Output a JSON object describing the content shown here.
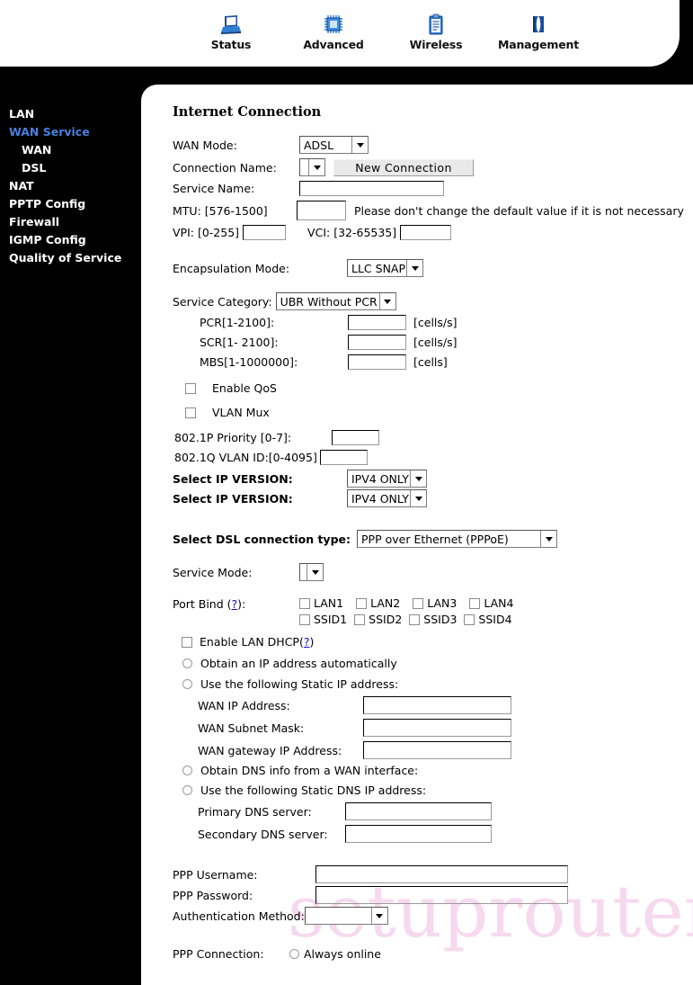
{
  "topnav": {
    "items": [
      {
        "label": "Status",
        "icon": "monitor-icon"
      },
      {
        "label": "Advanced",
        "icon": "chip-icon"
      },
      {
        "label": "Wireless",
        "icon": "clipboard-icon"
      },
      {
        "label": "Management",
        "icon": "book-icon"
      }
    ]
  },
  "sidebar": {
    "items": [
      {
        "label": "LAN",
        "active": false,
        "sub": false
      },
      {
        "label": "WAN Service",
        "active": true,
        "sub": false
      },
      {
        "label": "WAN",
        "active": false,
        "sub": true
      },
      {
        "label": "DSL",
        "active": false,
        "sub": true
      },
      {
        "label": "NAT",
        "active": false,
        "sub": false
      },
      {
        "label": "PPTP Config",
        "active": false,
        "sub": false
      },
      {
        "label": "Firewall",
        "active": false,
        "sub": false
      },
      {
        "label": "IGMP Config",
        "active": false,
        "sub": false
      },
      {
        "label": "Quality of Service",
        "active": false,
        "sub": false
      }
    ]
  },
  "watermark": {
    "text": "setuprouter"
  },
  "page": {
    "title": "Internet Connection",
    "wan_mode_label": "WAN Mode:",
    "wan_mode_value": "ADSL",
    "connection_name_label": "Connection Name:",
    "connection_name_value": "",
    "new_connection_button": "New Connection",
    "service_name_label": "Service Name:",
    "service_name_value": "",
    "mtu_label": "MTU: [576-1500]",
    "mtu_value": "",
    "mtu_note": "Please don't change the default value if it is not necessary",
    "vpi_label": "VPI: [0-255]",
    "vpi_value": "",
    "vci_label": "VCI: [32-65535]",
    "vci_value": "",
    "encapsulation_label": "Encapsulation Mode:",
    "encapsulation_value": "LLC SNAP",
    "service_category_label": "Service Category:",
    "service_category_value": "UBR Without PCR",
    "pcr_label": "PCR[1-2100]:",
    "pcr_value": "",
    "pcr_unit": "[cells/s]",
    "scr_label": "SCR[1- 2100]:",
    "scr_value": "",
    "scr_unit": "[cells/s]",
    "mbs_label": "MBS[1-1000000]:",
    "mbs_value": "",
    "mbs_unit": "[cells]",
    "enable_qos_label": "Enable QoS",
    "vlan_mux_label": "VLAN Mux",
    "p8021p_label": "802.1P Priority [0-7]:",
    "p8021p_value": "",
    "q8021q_label": "802.1Q VLAN ID:[0-4095]",
    "q8021q_value": "",
    "ip_version_label_1": "Select IP VERSION:",
    "ip_version_value_1": "IPV4 ONLY",
    "ip_version_label_2": "Select IP VERSION:",
    "ip_version_value_2": "IPV4 ONLY",
    "dsl_type_label": "Select DSL connection type:",
    "dsl_type_value": "PPP over Ethernet (PPPoE)",
    "service_mode_label": "Service Mode:",
    "service_mode_value": "",
    "port_bind_label": "Port Bind",
    "port_bind_help": "?",
    "port_bind_options_row1": [
      "LAN1",
      "LAN2",
      "LAN3",
      "LAN4"
    ],
    "port_bind_options_row2": [
      "SSID1",
      "SSID2",
      "SSID3",
      "SSID4"
    ],
    "enable_lan_dhcp_label": "Enable LAN DHCP",
    "enable_lan_dhcp_help": "?",
    "ip_auto_label": "Obtain an IP address automatically",
    "ip_static_label": "Use the following Static IP address:",
    "wan_ip_label": "WAN IP Address:",
    "wan_ip_value": "",
    "wan_mask_label": "WAN Subnet Mask:",
    "wan_mask_value": "",
    "wan_gw_label": "WAN gateway IP Address:",
    "wan_gw_value": "",
    "dns_auto_label": "Obtain DNS info from a WAN interface:",
    "dns_static_label": "Use the following Static DNS IP address:",
    "primary_dns_label": "Primary DNS server:",
    "primary_dns_value": "",
    "secondary_dns_label": "Secondary DNS server:",
    "secondary_dns_value": "",
    "ppp_username_label": "PPP Username:",
    "ppp_username_value": "",
    "ppp_password_label": "PPP Password:",
    "ppp_password_value": "",
    "auth_method_label": "Authentication Method:",
    "auth_method_value": "",
    "ppp_connection_label": "PPP Connection:",
    "always_online_label": "Always online"
  }
}
